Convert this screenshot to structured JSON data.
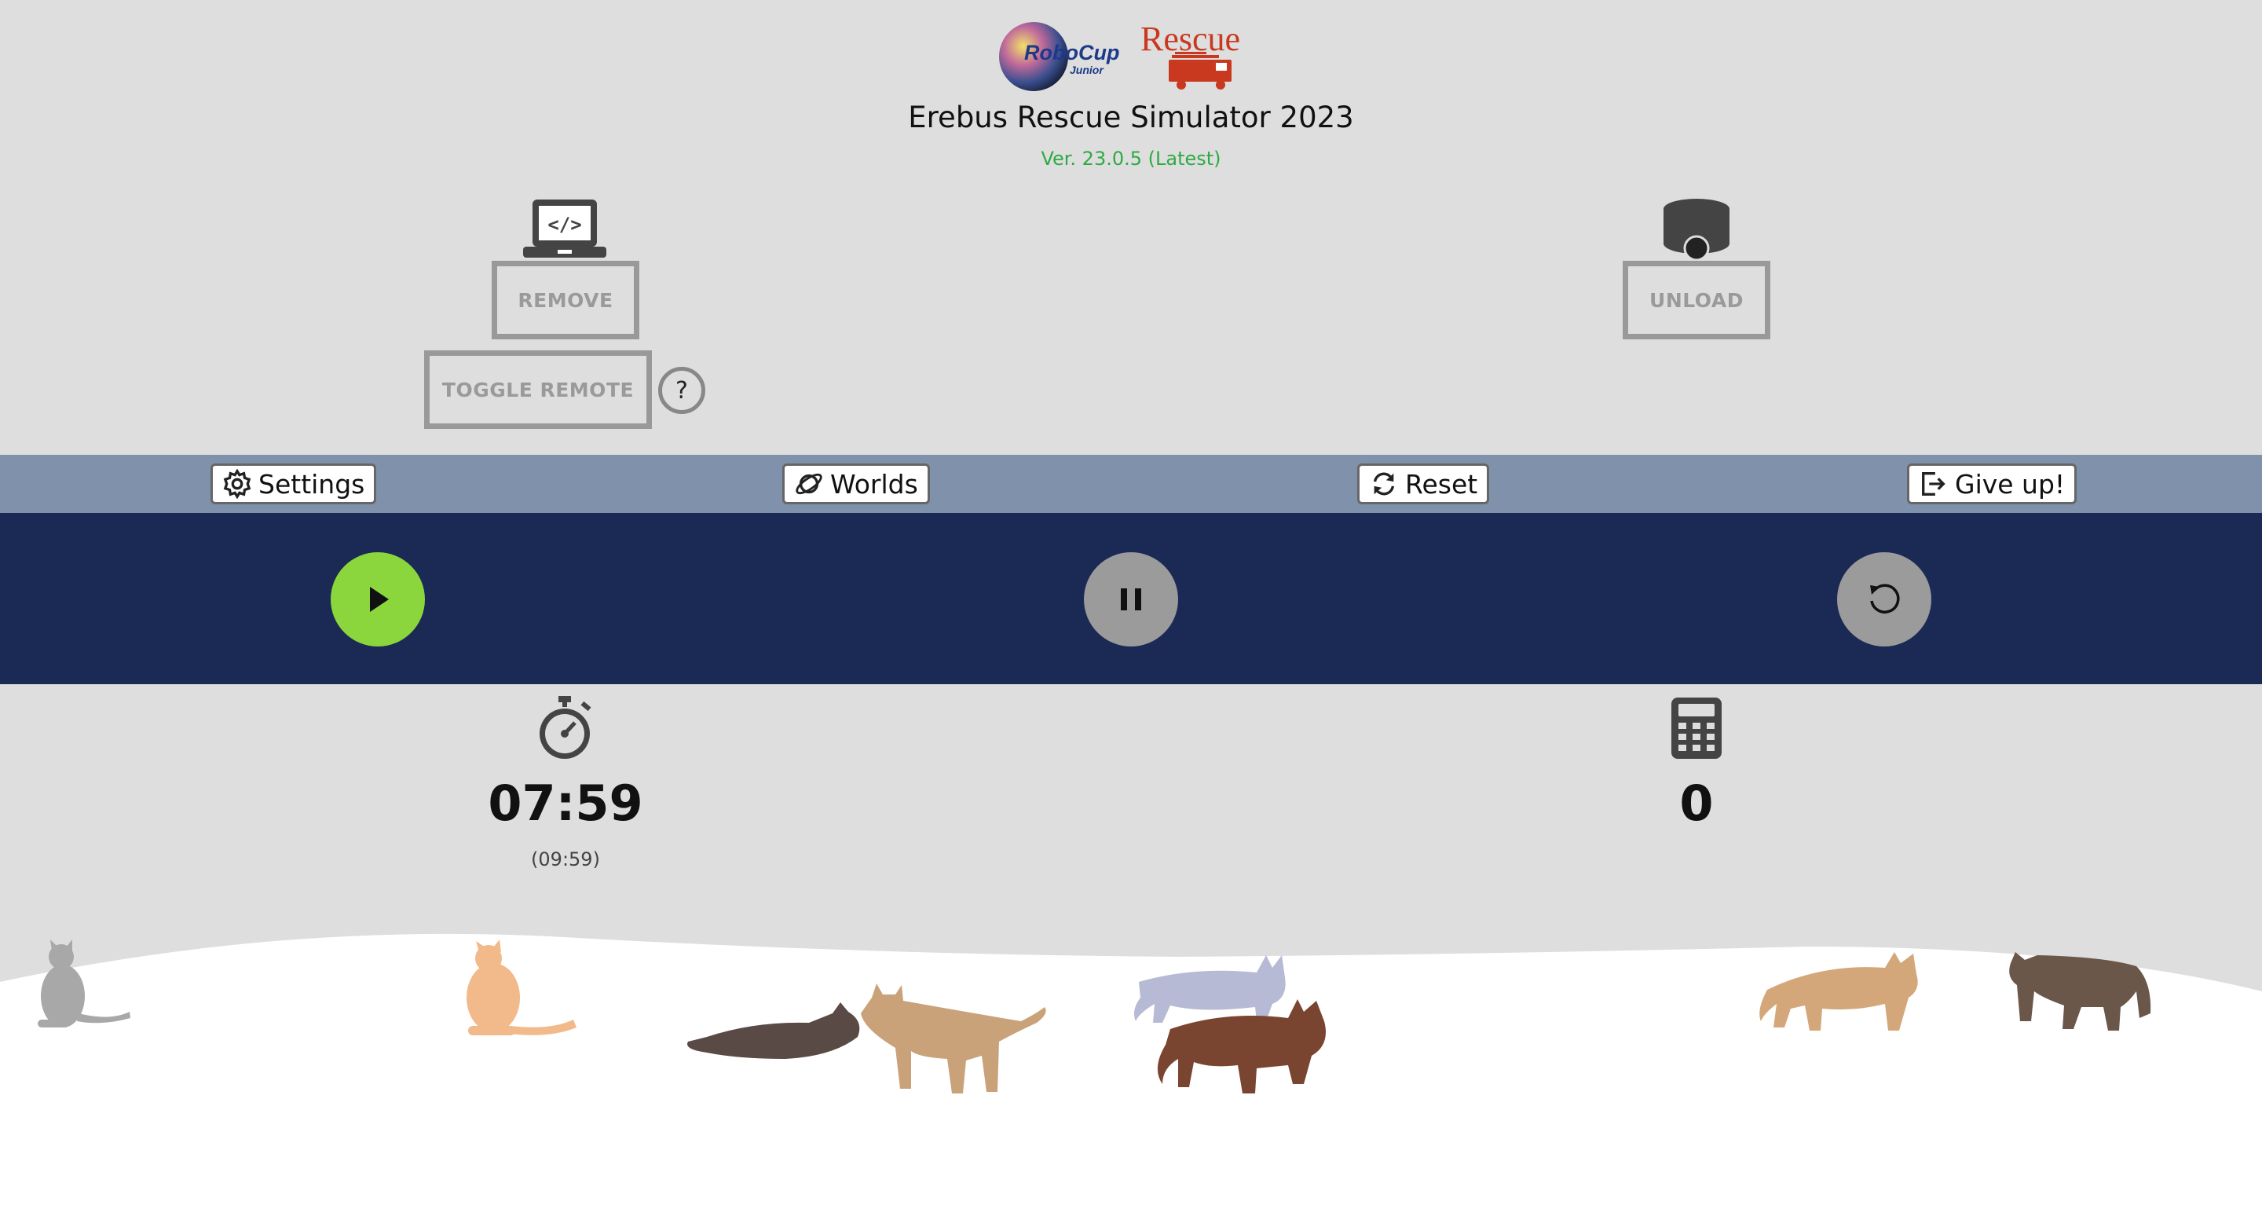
{
  "header": {
    "logo_robocup_text": "RoboCup",
    "logo_robocup_sub": "Junior",
    "logo_rescue_text": "Rescue",
    "title": "Erebus Rescue Simulator 2023",
    "version": "Ver. 23.0.5 (Latest)",
    "version_color": "#2eaa44"
  },
  "controller": {
    "icon": "laptop-code-icon",
    "remove_label": "REMOVE",
    "toggle_remote_label": "TOGGLE REMOTE",
    "help_label": "?"
  },
  "robot": {
    "icon": "robot-icon",
    "unload_label": "UNLOAD"
  },
  "toolbar": {
    "background": "#7f91ab",
    "settings_label": "Settings",
    "worlds_label": "Worlds",
    "reset_label": "Reset",
    "give_up_label": "Give up!"
  },
  "controls": {
    "background": "#1b2a55",
    "play_color": "#8bd63c",
    "disabled_color": "#9b9b9b",
    "play_icon": "play-icon",
    "pause_icon": "pause-icon",
    "restart_icon": "restart-icon"
  },
  "stats": {
    "timer_icon": "stopwatch-icon",
    "timer_value": "07:59",
    "timer_real": "(09:59)",
    "score_icon": "calculator-icon",
    "score_value": "0"
  },
  "footer": {
    "decoration": "cat-silhouettes-on-snow"
  }
}
